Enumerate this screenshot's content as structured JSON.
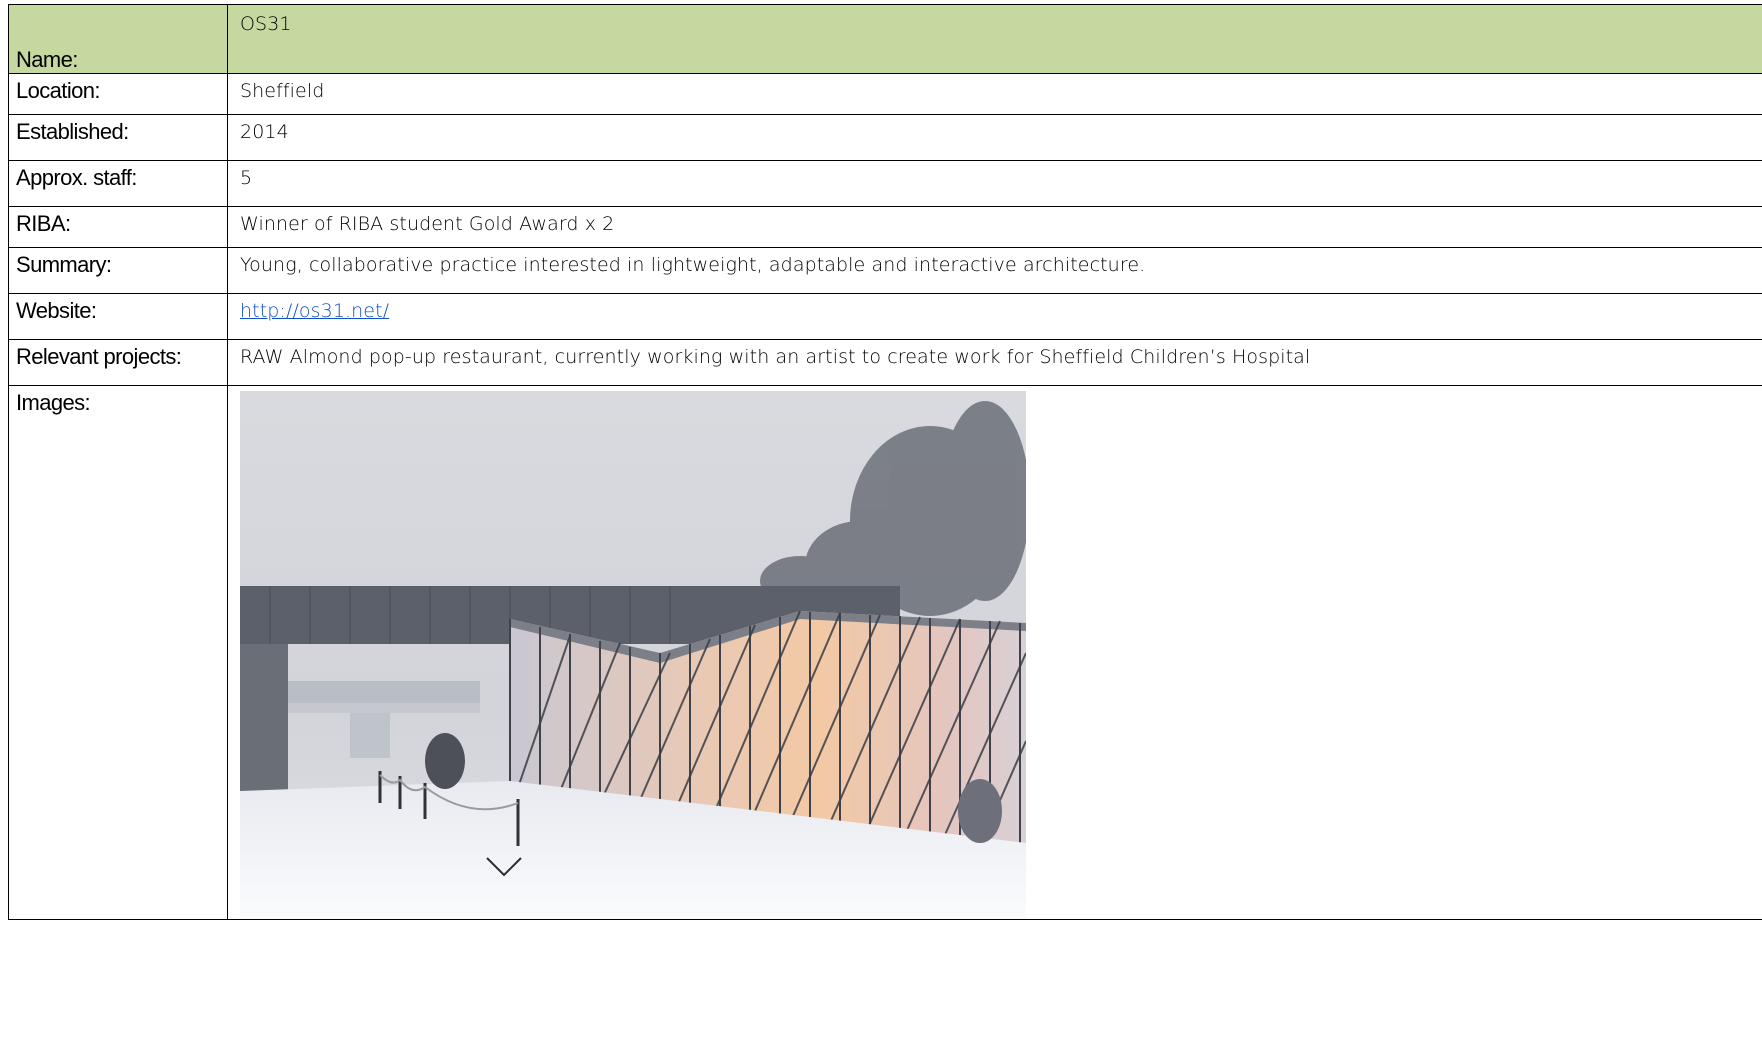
{
  "rows": [
    {
      "label": "Name:",
      "value": "OS31"
    },
    {
      "label": "Location:",
      "value": "Sheffield"
    },
    {
      "label": "Established:",
      "value": "2014"
    },
    {
      "label": "Approx. staff:",
      "value": "5"
    },
    {
      "label": "RIBA:",
      "value": "Winner of RIBA student Gold Award x 2"
    },
    {
      "label": "Summary:",
      "value": "Young, collaborative practice interested in lightweight, adaptable and interactive architecture."
    },
    {
      "label": "Website:",
      "value": "http://os31.net/"
    },
    {
      "label": "Relevant projects:",
      "value": "RAW Almond pop-up restaurant, currently working with an artist to create work for Sheffield Children’s Hospital"
    },
    {
      "label": "Images:"
    }
  ],
  "colors": {
    "header_fill": "#c5d8a0",
    "link": "#0f4fc7",
    "border": "#000000"
  },
  "icons": {
    "photo_overlay": "chevron-down-icon"
  }
}
